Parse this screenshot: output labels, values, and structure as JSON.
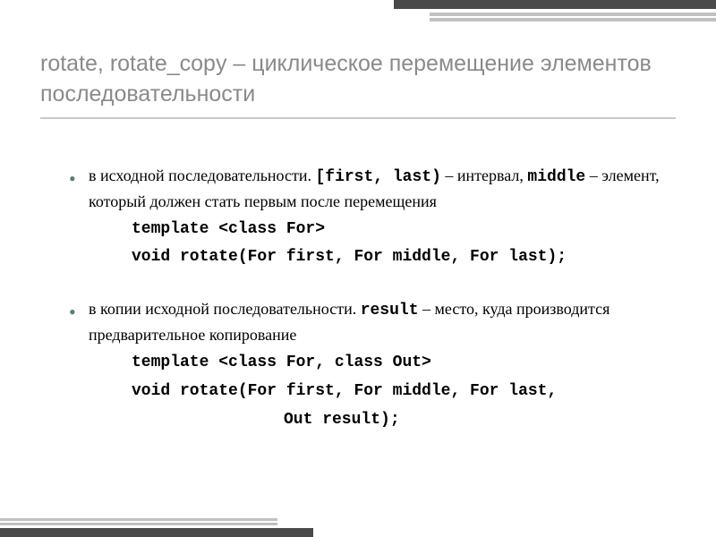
{
  "title": "rotate, rotate_copy – циклическое перемещение элементов последовательности",
  "bullet1": {
    "prefix": "в исходной последовательности. ",
    "code1": "[first, last)",
    "mid1": " – интервал, ",
    "code2": "middle",
    "suffix": " – элемент, который должен стать первым после перемещения"
  },
  "code1": {
    "l1": "template <class For>",
    "l2": "void rotate(For first, For middle, For last);"
  },
  "bullet2": {
    "prefix": "в копии исходной последовательности. ",
    "code1": "result",
    "suffix": " – место, куда производится предварительное копирование"
  },
  "code2": {
    "l1": "template <class For, class Out>",
    "l2": "void rotate(For first, For middle, For last,",
    "l3": "Out result);"
  }
}
